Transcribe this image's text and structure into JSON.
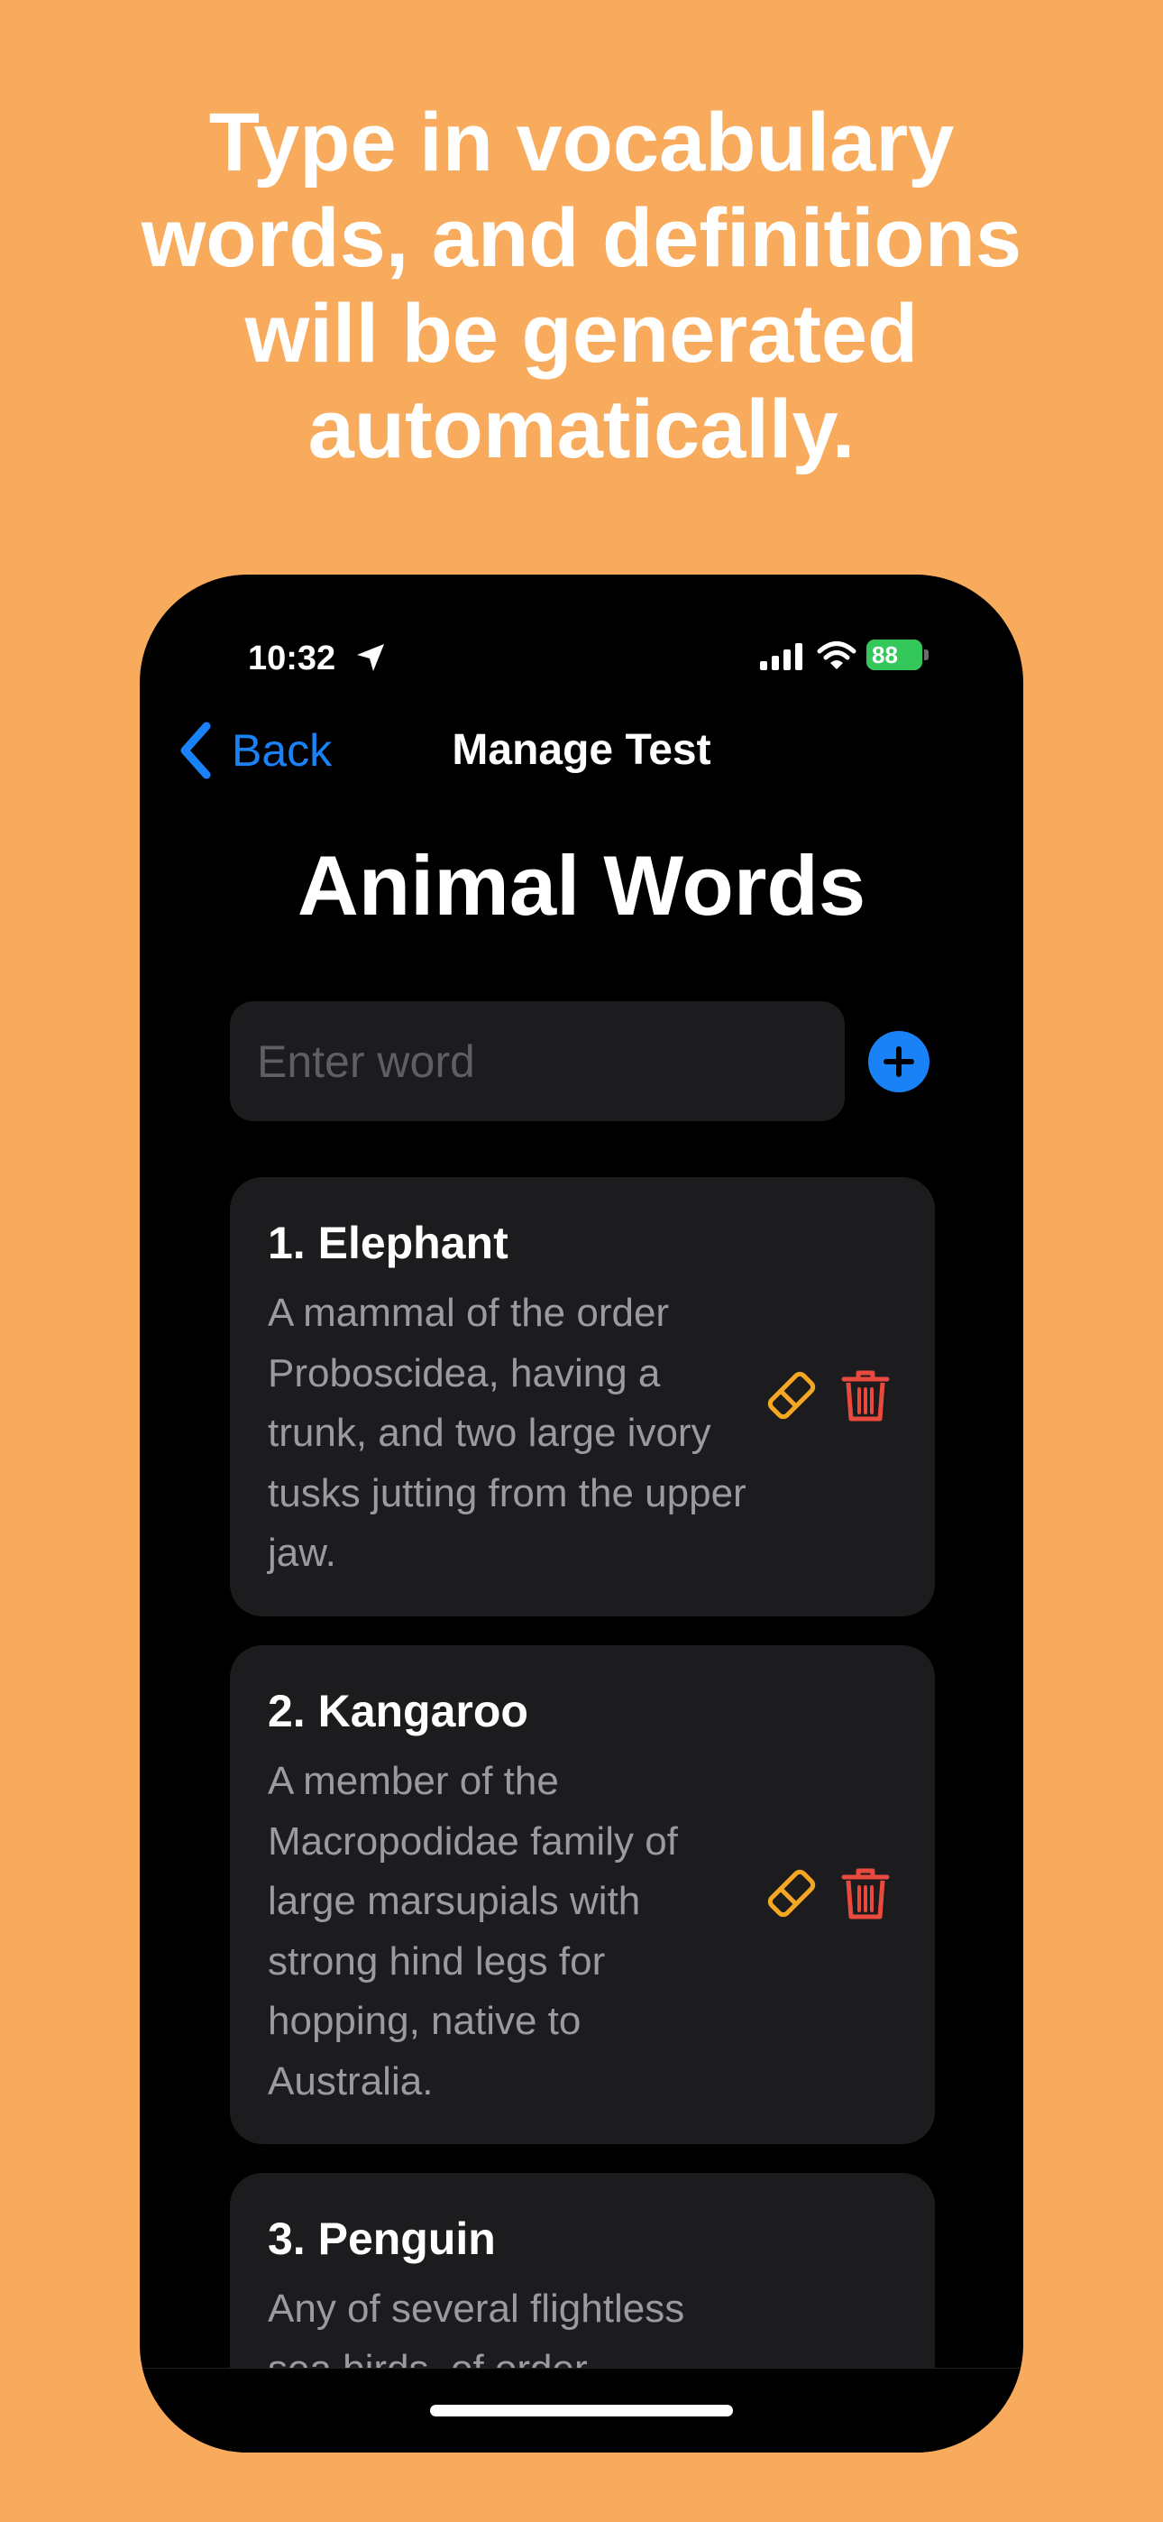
{
  "promo": {
    "headline": "Type in vocabulary words, and definitions will be generated automatically."
  },
  "status_bar": {
    "time": "10:32",
    "battery": "88"
  },
  "nav": {
    "back_label": "Back",
    "title": "Manage Test"
  },
  "page": {
    "title": "Animal Words"
  },
  "input": {
    "placeholder": "Enter word",
    "value": ""
  },
  "words": [
    {
      "title": "1. Elephant",
      "definition": "A mammal of the order Proboscidea, having a trunk, and two large ivory tusks jutting from the upper jaw."
    },
    {
      "title": "2. Kangaroo",
      "definition": "A member of the Macropodidae family of large marsupials with strong hind legs for hopping, native to Australia."
    },
    {
      "title": "3. Penguin",
      "definition": "Any of several flightless sea birds, of order"
    }
  ],
  "colors": {
    "background": "#F8AB5C",
    "accent": "#1A82F7",
    "edit": "#F5A623",
    "delete": "#E84A3E",
    "card": "#1C1C1E"
  },
  "icons": [
    "location-icon",
    "signal-icon",
    "wifi-icon",
    "battery-icon",
    "chevron-left-icon",
    "plus-icon",
    "eraser-icon",
    "trash-icon"
  ]
}
